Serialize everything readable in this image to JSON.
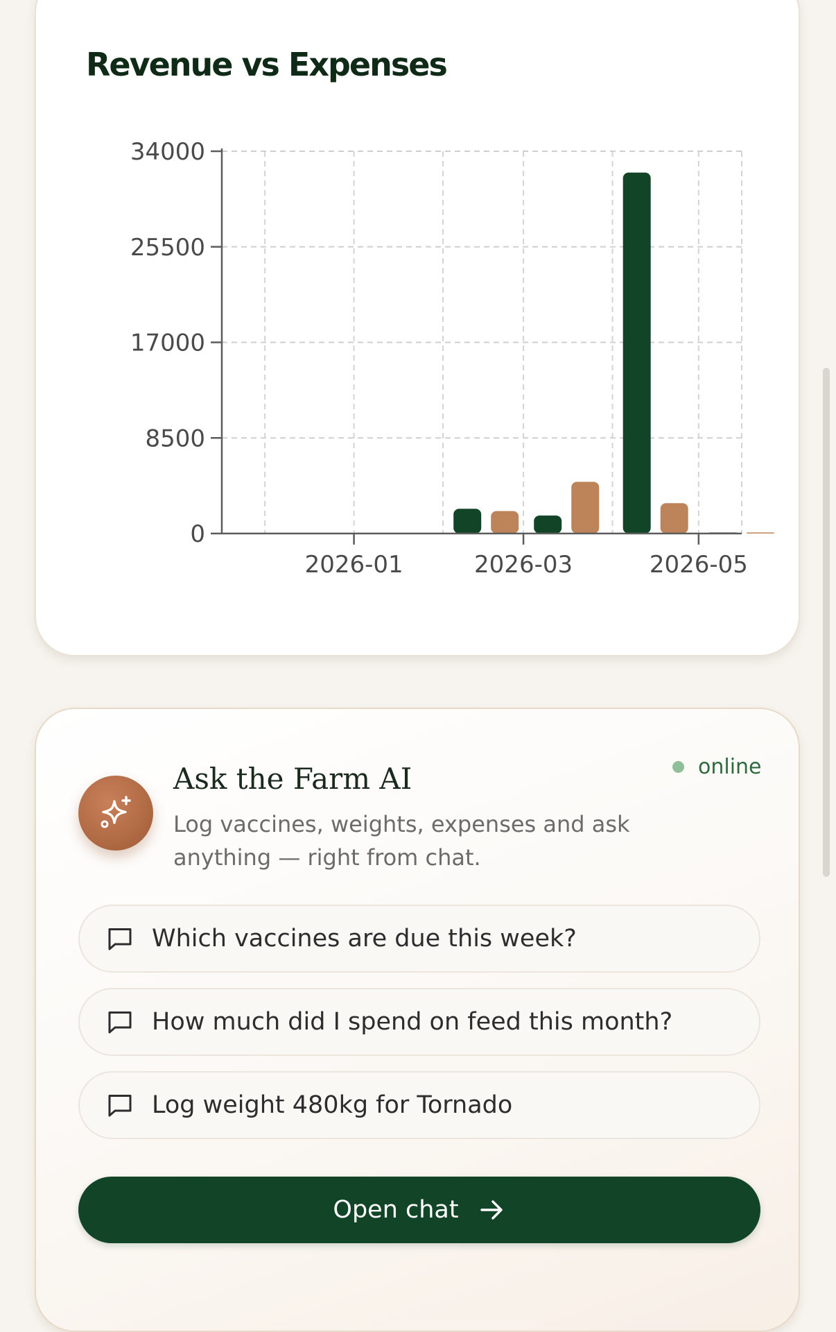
{
  "chart_card": {
    "title": "Revenue vs Expenses"
  },
  "chart_data": {
    "type": "bar",
    "title": "Revenue vs Expenses",
    "xlabel": "",
    "ylabel": "",
    "ylim": [
      0,
      34000
    ],
    "y_ticks": [
      "34000",
      "25500",
      "17000",
      "8500",
      "0"
    ],
    "y_tick_values": [
      34000,
      25500,
      17000,
      8500,
      0
    ],
    "x_tick_labels": [
      "2026-01",
      "2026-03",
      "2026-05"
    ],
    "x_tick_dates": [
      "2026-01-01",
      "2026-03-01",
      "2026-05-01"
    ],
    "x_range": [
      "2025-11-16",
      "2026-05-16"
    ],
    "grid": true,
    "legend": "none",
    "categories": [
      "2026-02",
      "2026-03",
      "2026-04",
      "2026-05"
    ],
    "series": [
      {
        "values": [
          2200,
          1600,
          32100,
          0
        ],
        "color": "#124428"
      },
      {
        "values": [
          2000,
          4600,
          2700,
          80
        ],
        "color": "#bd8459"
      }
    ]
  },
  "ai_card": {
    "title": "Ask the Farm AI",
    "description": "Log vaccines, weights, expenses and ask anything — right from chat.",
    "status": "online",
    "avatar_icon": "sparkles-icon",
    "suggestion_icon": "chat-bubble-icon",
    "suggestions": [
      "Which vaccines are due this week?",
      "How much did I spend on feed this month?",
      "Log weight 480kg for Tornado"
    ],
    "open_chat_label": "Open chat",
    "open_chat_icon": "arrow-right-icon"
  },
  "colors": {
    "revenue": "#124428",
    "expenses": "#bd8459",
    "primary_button": "#124428",
    "online_dot": "#8fbf98",
    "avatar": "#b06a44"
  }
}
